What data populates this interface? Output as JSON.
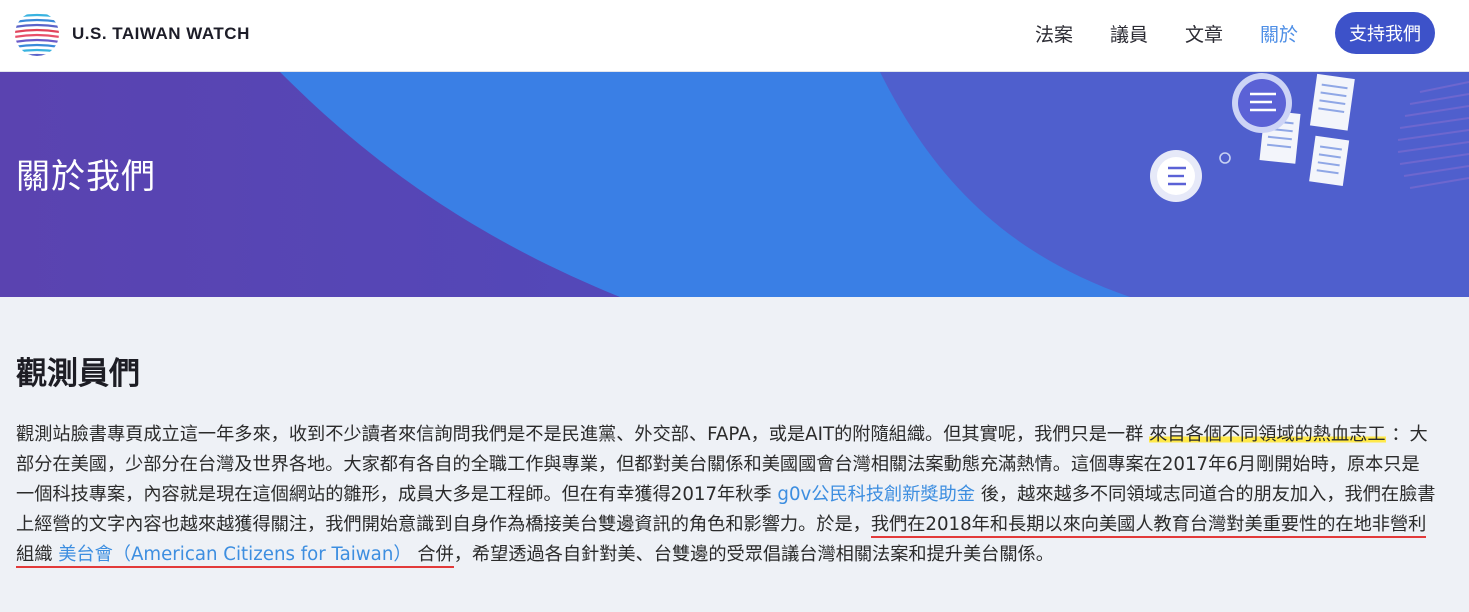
{
  "header": {
    "brand": "U.S. TAIWAN WATCH",
    "nav": [
      {
        "label": "法案"
      },
      {
        "label": "議員"
      },
      {
        "label": "文章"
      },
      {
        "label": "關於",
        "active": true
      }
    ],
    "cta_label": "支持我們"
  },
  "banner": {
    "title": "關於我們"
  },
  "section": {
    "title": "觀測員們",
    "para": {
      "t1": "觀測站臉書專頁成立這一年多來，收到不少讀者來信詢問我們是不是民進黨、外交部、FAPA，或是AIT的附隨組織。但其實呢，我們只是一群",
      "h1": "來自各個不同領域的熱血志工",
      "t2": "：大部分在美國，少部分在台灣及世界各地。大家都有各自的全職工作與專業，但都對美台關係和美國國會台灣相關法案動態充滿熱情。這個專案在2017年6月剛開始時，原本只是一個科技專案，內容就是現在這個網站的雛形，成員大多是工程師。但在有幸獲得2017年秋季",
      "link1": "g0v公民科技創新獎助金",
      "t3": "後，越來越多不同領域志同道合的朋友加入，我們在臉書上經營的文字內容也越來越獲得關注，我們開始意識到自身作為橋接美台雙邊資訊的角色和影響力。於是，",
      "u1": "我們在2018年和長期以來向美國人教育台灣對美重要性的在地非營利組織",
      "link2": "美台會（American Citizens for Taiwan）",
      "u2": "合併",
      "t4": "，希望透過各自針對美、台雙邊的受眾倡議台灣相關法案和提升美台關係。"
    }
  },
  "colors": {
    "cta_bg": "#3d52c9",
    "active_nav": "#4f8fe6",
    "banner_base": "#5346b6",
    "banner_wave": "#3a7fe5",
    "link": "#3d8ee0",
    "highlight": "#ffe94a",
    "underline": "#e23a3a"
  }
}
